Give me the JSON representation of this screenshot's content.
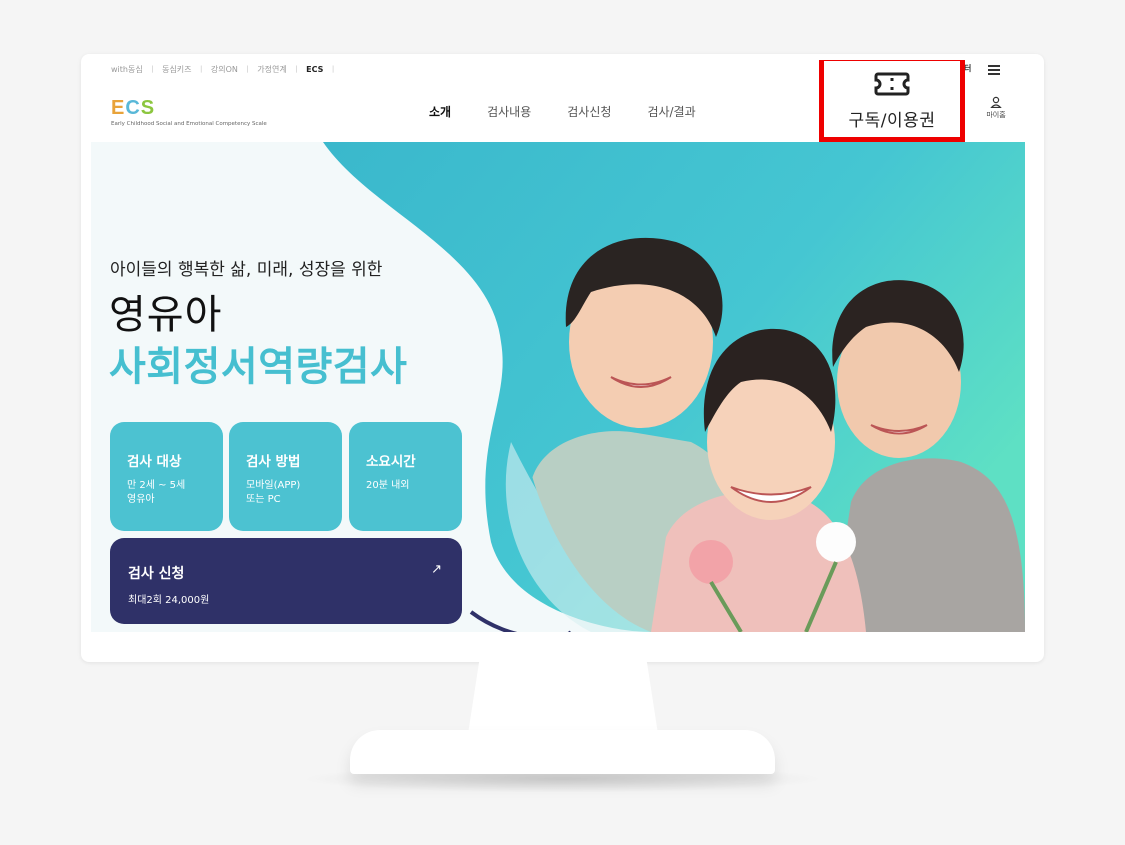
{
  "top_links": [
    "with동심",
    "동심키즈",
    "강의ON",
    "가정연계",
    "ECS"
  ],
  "top_right_text": "터",
  "logo": {
    "mark": [
      "E",
      "C",
      "S"
    ],
    "tagline": "Early Childhood Social and Emotional Competency Scale"
  },
  "main_nav": [
    "소개",
    "검사내용",
    "검사신청",
    "검사/결과"
  ],
  "subscription": {
    "label": "구독/이용권"
  },
  "mypage": {
    "label": "마이홈"
  },
  "hero": {
    "subtitle": "아이들의 행복한 삶, 미래, 성장을 위한",
    "title_line1": "영유아",
    "title_line2": "사회정서역량검사"
  },
  "cards": [
    {
      "title": "검사 대상",
      "desc1": "만 2세 ~ 5세",
      "desc2": "영유아"
    },
    {
      "title": "검사 방법",
      "desc1": "모바일(APP)",
      "desc2": "또는 PC"
    },
    {
      "title": "소요시간",
      "desc1": "20분 내외",
      "desc2": ""
    }
  ],
  "apply": {
    "title": "검사 신청",
    "desc": "최대2회 24,000원",
    "arrow": "↗"
  },
  "colors": {
    "accent": "#46bfd0",
    "card": "#4cc2d1",
    "apply": "#2f3168",
    "highlight": "#ee0000"
  }
}
